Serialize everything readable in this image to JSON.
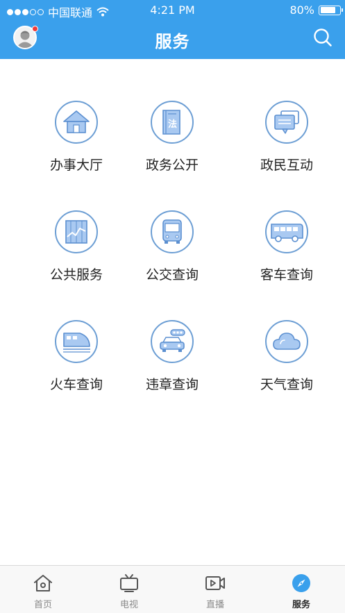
{
  "status_bar": {
    "carrier": "中国联通",
    "time": "4:21 PM",
    "battery": "80%",
    "battery_level": 0.8,
    "signal_bars": 3
  },
  "header": {
    "title": "服务",
    "avatar_icon": "user-avatar-icon",
    "search_icon": "search-icon",
    "background": "#3aa0ec",
    "notification_color": "#f03a3a"
  },
  "services": [
    {
      "label": "办事大厅",
      "icon": "house-icon"
    },
    {
      "label": "政务公开",
      "icon": "law-book-icon",
      "icon_text": "法"
    },
    {
      "label": "政民互动",
      "icon": "chat-bubbles-icon"
    },
    {
      "label": "公共服务",
      "icon": "chart-panel-icon"
    },
    {
      "label": "公交查询",
      "icon": "bus-front-icon"
    },
    {
      "label": "客车查询",
      "icon": "coach-side-icon"
    },
    {
      "label": "火车查询",
      "icon": "train-icon"
    },
    {
      "label": "违章查询",
      "icon": "car-traffic-light-icon"
    },
    {
      "label": "天气查询",
      "icon": "cloud-icon"
    }
  ],
  "icon_colors": {
    "ring": "#6c9ed4",
    "fill": "#a9c9f1",
    "stroke": "#5b8fd0"
  },
  "tabs": [
    {
      "label": "首页",
      "icon": "home-icon",
      "active": false
    },
    {
      "label": "电视",
      "icon": "tv-icon",
      "active": false
    },
    {
      "label": "直播",
      "icon": "live-video-icon",
      "active": false
    },
    {
      "label": "服务",
      "icon": "compass-icon",
      "active": true
    }
  ],
  "tab_active_color": "#3aa0ec"
}
